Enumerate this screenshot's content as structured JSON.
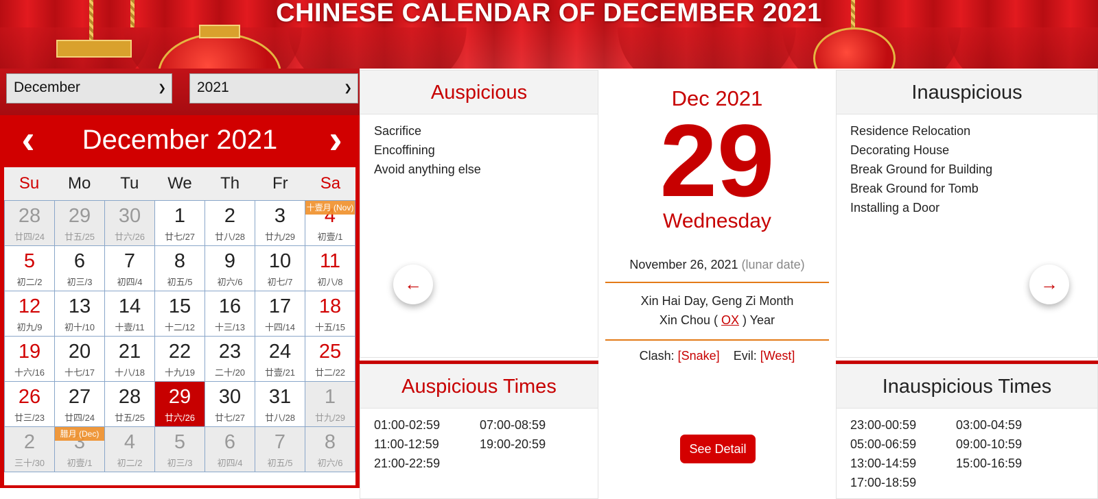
{
  "header": {
    "title": "CHINESE CALENDAR OF DECEMBER 2021"
  },
  "selectors": {
    "month": "December",
    "year": "2021"
  },
  "calendar": {
    "title": "December 2021",
    "prev_icon": "chevron-left-icon",
    "next_icon": "chevron-right-icon",
    "weekdays": [
      "Su",
      "Mo",
      "Tu",
      "We",
      "Th",
      "Fr",
      "Sa"
    ],
    "days": [
      {
        "n": "28",
        "l": "廿四/24",
        "other": true
      },
      {
        "n": "29",
        "l": "廿五/25",
        "other": true
      },
      {
        "n": "30",
        "l": "廿六/26",
        "other": true
      },
      {
        "n": "1",
        "l": "廿七/27"
      },
      {
        "n": "2",
        "l": "廿八/28"
      },
      {
        "n": "3",
        "l": "廿九/29"
      },
      {
        "n": "4",
        "l": "初壹/1",
        "tag": "十壹月 (Nov)"
      },
      {
        "n": "5",
        "l": "初二/2"
      },
      {
        "n": "6",
        "l": "初三/3"
      },
      {
        "n": "7",
        "l": "初四/4"
      },
      {
        "n": "8",
        "l": "初五/5"
      },
      {
        "n": "9",
        "l": "初六/6"
      },
      {
        "n": "10",
        "l": "初七/7"
      },
      {
        "n": "11",
        "l": "初八/8"
      },
      {
        "n": "12",
        "l": "初九/9"
      },
      {
        "n": "13",
        "l": "初十/10"
      },
      {
        "n": "14",
        "l": "十壹/11"
      },
      {
        "n": "15",
        "l": "十二/12"
      },
      {
        "n": "16",
        "l": "十三/13"
      },
      {
        "n": "17",
        "l": "十四/14"
      },
      {
        "n": "18",
        "l": "十五/15"
      },
      {
        "n": "19",
        "l": "十六/16"
      },
      {
        "n": "20",
        "l": "十七/17"
      },
      {
        "n": "21",
        "l": "十八/18"
      },
      {
        "n": "22",
        "l": "十九/19"
      },
      {
        "n": "23",
        "l": "二十/20"
      },
      {
        "n": "24",
        "l": "廿壹/21"
      },
      {
        "n": "25",
        "l": "廿二/22"
      },
      {
        "n": "26",
        "l": "廿三/23"
      },
      {
        "n": "27",
        "l": "廿四/24"
      },
      {
        "n": "28",
        "l": "廿五/25"
      },
      {
        "n": "29",
        "l": "廿六/26",
        "selected": true
      },
      {
        "n": "30",
        "l": "廿七/27"
      },
      {
        "n": "31",
        "l": "廿八/28"
      },
      {
        "n": "1",
        "l": "廿九/29",
        "other": true
      },
      {
        "n": "2",
        "l": "三十/30",
        "other": true
      },
      {
        "n": "3",
        "l": "初壹/1",
        "other": true,
        "tag": "腊月 (Dec)"
      },
      {
        "n": "4",
        "l": "初二/2",
        "other": true
      },
      {
        "n": "5",
        "l": "初三/3",
        "other": true
      },
      {
        "n": "6",
        "l": "初四/4",
        "other": true
      },
      {
        "n": "7",
        "l": "初五/5",
        "other": true
      },
      {
        "n": "8",
        "l": "初六/6",
        "other": true
      }
    ]
  },
  "auspicious": {
    "title": "Auspicious",
    "items": [
      "Sacrifice",
      "Encoffining",
      "Avoid anything else"
    ]
  },
  "auspicious_times": {
    "title": "Auspicious Times",
    "items": [
      "01:00-02:59",
      "07:00-08:59",
      "11:00-12:59",
      "19:00-20:59",
      "21:00-22:59"
    ]
  },
  "inauspicious": {
    "title": "Inauspicious",
    "items": [
      "Residence Relocation",
      "Decorating House",
      "Break Ground for Building",
      "Break Ground for Tomb",
      "Installing a Door"
    ]
  },
  "inauspicious_times": {
    "title": "Inauspicious Times",
    "items": [
      "23:00-00:59",
      "03:00-04:59",
      "05:00-06:59",
      "09:00-10:59",
      "13:00-14:59",
      "15:00-16:59",
      "17:00-18:59"
    ]
  },
  "day_detail": {
    "month_year": "Dec 2021",
    "day": "29",
    "weekday": "Wednesday",
    "lunar_date": "November 26, 2021",
    "lunar_note": "(lunar date)",
    "ganzhi_line1": "Xin Hai Day, Geng Zi Month",
    "year_prefix": "Xin Chou (",
    "zodiac": "OX",
    "year_suffix": ") Year",
    "clash_label": "Clash:",
    "clash_value": "[Snake]",
    "evil_label": "Evil:",
    "evil_value": "[West]",
    "detail_button": "See Detail"
  },
  "nav": {
    "prev_icon": "arrow-left-icon",
    "next_icon": "arrow-right-icon"
  }
}
